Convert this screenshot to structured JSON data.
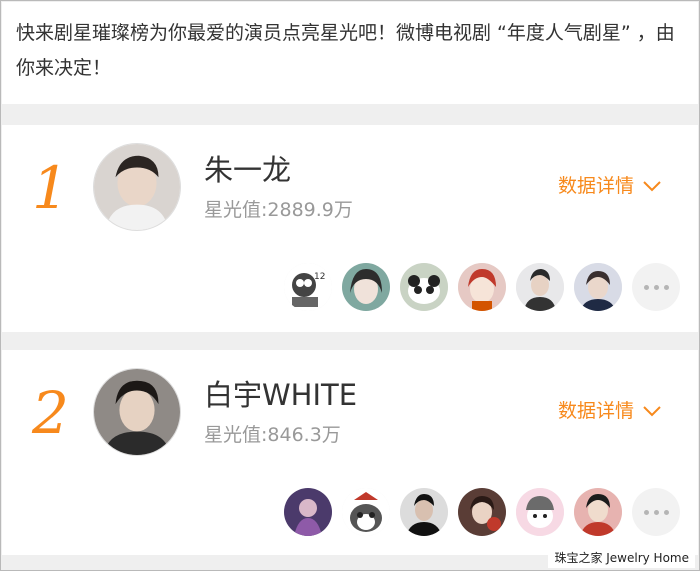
{
  "intro": {
    "text": "快来剧星璀璨榜为你最爱的演员点亮星光吧！微博电视剧 “年度人气剧星” ，由你来决定！"
  },
  "entries": [
    {
      "rank": "1",
      "name": "朱一龙",
      "score": "星光值:2889.9万",
      "detail_label": "数据详情",
      "fans": [
        "fan-avatar-1",
        "fan-avatar-2",
        "fan-avatar-3",
        "fan-avatar-4",
        "fan-avatar-5",
        "fan-avatar-6"
      ]
    },
    {
      "rank": "2",
      "name": "白宇WHITE",
      "score": "星光值:846.3万",
      "detail_label": "数据详情",
      "fans": [
        "fan-avatar-1",
        "fan-avatar-2",
        "fan-avatar-3",
        "fan-avatar-4",
        "fan-avatar-5",
        "fan-avatar-6"
      ]
    }
  ],
  "watermark": "珠宝之家  Jewelry Home",
  "colors": {
    "accent": "#f7891c",
    "text": "#333333",
    "muted": "#999999",
    "background": "#efefef"
  }
}
